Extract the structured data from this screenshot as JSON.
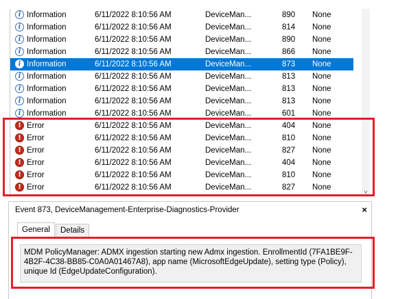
{
  "events": [
    {
      "level": "Information",
      "icon": "info-icon",
      "date": "6/11/2022 8:10:56 AM",
      "source": "DeviceMan...",
      "id": "890",
      "task": "None"
    },
    {
      "level": "Information",
      "icon": "info-icon",
      "date": "6/11/2022 8:10:56 AM",
      "source": "DeviceMan...",
      "id": "814",
      "task": "None"
    },
    {
      "level": "Information",
      "icon": "info-icon",
      "date": "6/11/2022 8:10:56 AM",
      "source": "DeviceMan...",
      "id": "890",
      "task": "None"
    },
    {
      "level": "Information",
      "icon": "info-icon",
      "date": "6/11/2022 8:10:56 AM",
      "source": "DeviceMan...",
      "id": "866",
      "task": "None"
    },
    {
      "level": "Information",
      "icon": "info-icon",
      "date": "6/11/2022 8:10:56 AM",
      "source": "DeviceMan...",
      "id": "873",
      "task": "None",
      "selected": true
    },
    {
      "level": "Information",
      "icon": "info-icon",
      "date": "6/11/2022 8:10:56 AM",
      "source": "DeviceMan...",
      "id": "813",
      "task": "None"
    },
    {
      "level": "Information",
      "icon": "info-icon",
      "date": "6/11/2022 8:10:56 AM",
      "source": "DeviceMan...",
      "id": "813",
      "task": "None"
    },
    {
      "level": "Information",
      "icon": "info-icon",
      "date": "6/11/2022 8:10:56 AM",
      "source": "DeviceMan...",
      "id": "813",
      "task": "None"
    },
    {
      "level": "Information",
      "icon": "info-icon",
      "date": "6/11/2022 8:10:56 AM",
      "source": "DeviceMan...",
      "id": "601",
      "task": "None"
    },
    {
      "level": "Error",
      "icon": "error-icon",
      "date": "6/11/2022 8:10:56 AM",
      "source": "DeviceMan...",
      "id": "404",
      "task": "None"
    },
    {
      "level": "Error",
      "icon": "error-icon",
      "date": "6/11/2022 8:10:56 AM",
      "source": "DeviceMan...",
      "id": "810",
      "task": "None"
    },
    {
      "level": "Error",
      "icon": "error-icon",
      "date": "6/11/2022 8:10:56 AM",
      "source": "DeviceMan...",
      "id": "827",
      "task": "None"
    },
    {
      "level": "Error",
      "icon": "error-icon",
      "date": "6/11/2022 8:10:56 AM",
      "source": "DeviceMan...",
      "id": "404",
      "task": "None"
    },
    {
      "level": "Error",
      "icon": "error-icon",
      "date": "6/11/2022 8:10:56 AM",
      "source": "DeviceMan...",
      "id": "810",
      "task": "None"
    },
    {
      "level": "Error",
      "icon": "error-icon",
      "date": "6/11/2022 8:10:56 AM",
      "source": "DeviceMan...",
      "id": "827",
      "task": "None"
    }
  ],
  "details": {
    "title": "Event 873, DeviceManagement-Enterprise-Diagnostics-Provider",
    "close_glyph": "×",
    "tabs": [
      {
        "label": "General",
        "active": true
      },
      {
        "label": "Details",
        "active": false
      }
    ],
    "message": "MDM PolicyManager: ADMX ingestion starting new Admx ingestion. EnrollmentId (7FA1BE9F-4B2F-4C38-BB85-C0A0A01467A8), app name (MicrosoftEdgeUpdate), setting type (Policy), unique Id (EdgeUpdateConfiguration)."
  },
  "scrollbar": {
    "down_glyph": "˅"
  },
  "colors": {
    "selection": "#0078d7",
    "highlight_box": "#e0202a",
    "error_icon": "#c42b1c",
    "info_icon": "#3a6fb5"
  }
}
